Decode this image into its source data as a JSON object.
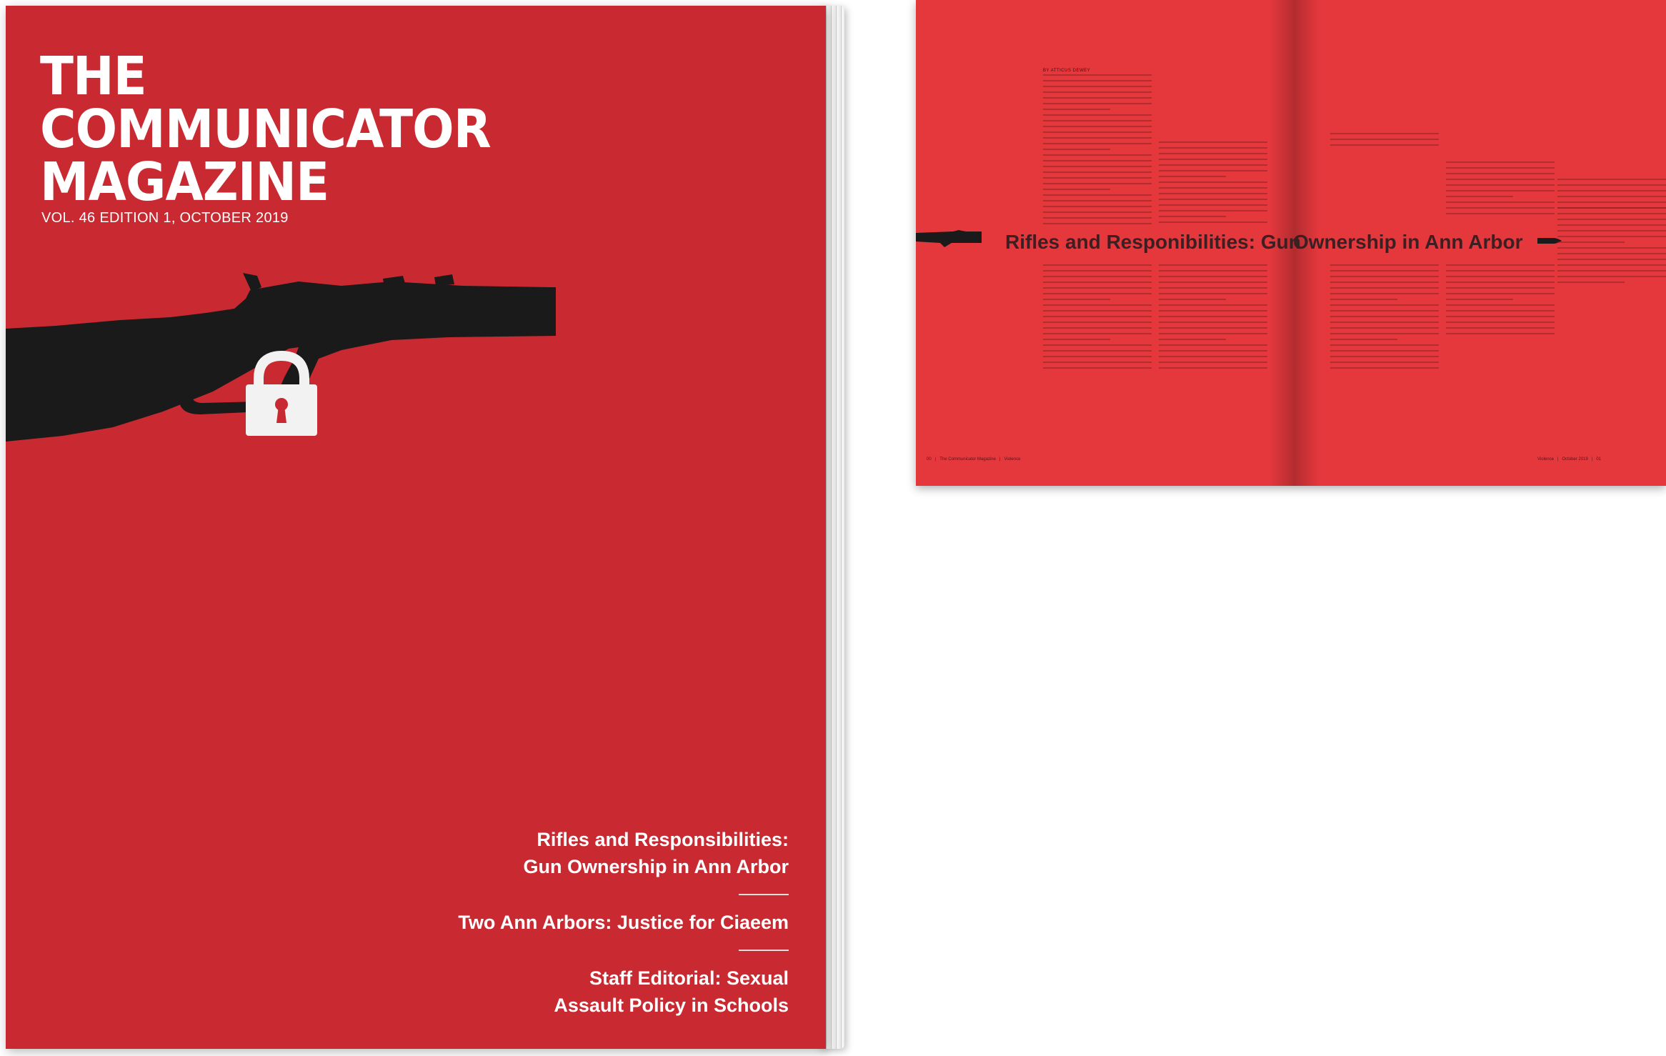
{
  "cover": {
    "title_lines": [
      "THE",
      "COMMUNICATOR",
      "MAGAZINE"
    ],
    "volume": "VOL. 46 EDITION 1, OCTOBER 2019",
    "headlines": [
      [
        "Rifles and Responsibilities:",
        "Gun Ownership in Ann Arbor"
      ],
      [
        "Two Ann Arbors: Justice for Ciaeem"
      ],
      [
        "Staff Editorial: Sexual",
        "Assault Policy in Schools"
      ]
    ]
  },
  "spread": {
    "byline": "BY ATTICUS DEWEY",
    "title_left": "Rifles and Responibilities: Gun",
    "title_right": "Ownership in Ann Arbor",
    "footer_left": {
      "page": "00",
      "publication": "The Communicator Magazine",
      "section": "Violence"
    },
    "footer_right": {
      "section": "Violence",
      "date": "October 2019",
      "page": "01"
    }
  },
  "colors": {
    "cover_red": "#c92a32",
    "spread_red": "#e5383d",
    "silhouette": "#1a1a1a",
    "lock": "#f2f2f2"
  },
  "icons": {
    "cover_art": "rifle-with-padlock-icon",
    "spread_left_art": "rifle-icon",
    "spread_right_art": "bullet-icon"
  }
}
